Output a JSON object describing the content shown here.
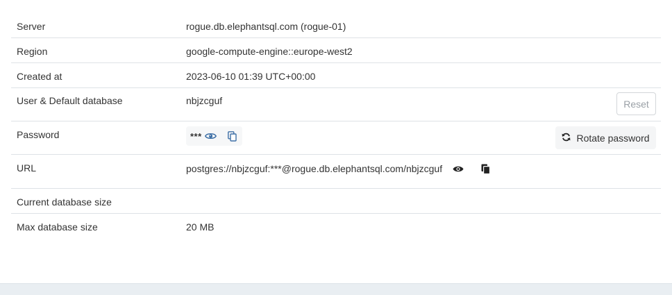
{
  "rows": {
    "server": {
      "label": "Server",
      "value": "rogue.db.elephantsql.com (rogue-01)"
    },
    "region": {
      "label": "Region",
      "value": "google-compute-engine::europe-west2"
    },
    "created": {
      "label": "Created at",
      "value": "2023-06-10 01:39 UTC+00:00"
    },
    "user": {
      "label": "User & Default database",
      "value": "nbjzcguf",
      "reset_label": "Reset"
    },
    "password": {
      "label": "Password",
      "masked": "***",
      "rotate_label": "Rotate password"
    },
    "url": {
      "label": "URL",
      "value": "postgres://nbjzcguf:***@rogue.db.elephantsql.com/nbjzcguf"
    },
    "current_size": {
      "label": "Current database size",
      "value": ""
    },
    "max_size": {
      "label": "Max database size",
      "value": "20 MB"
    }
  },
  "icons": {
    "password_show": "eye-icon",
    "password_copy": "copy-icon",
    "rotate": "refresh-icon",
    "url_show": "eye-icon",
    "url_copy": "copy-icon"
  },
  "colors": {
    "divider": "#dee2e6",
    "icon_blue": "#3d6fa6",
    "icon_dark": "#222222",
    "reset_text": "#9aa0a6"
  }
}
